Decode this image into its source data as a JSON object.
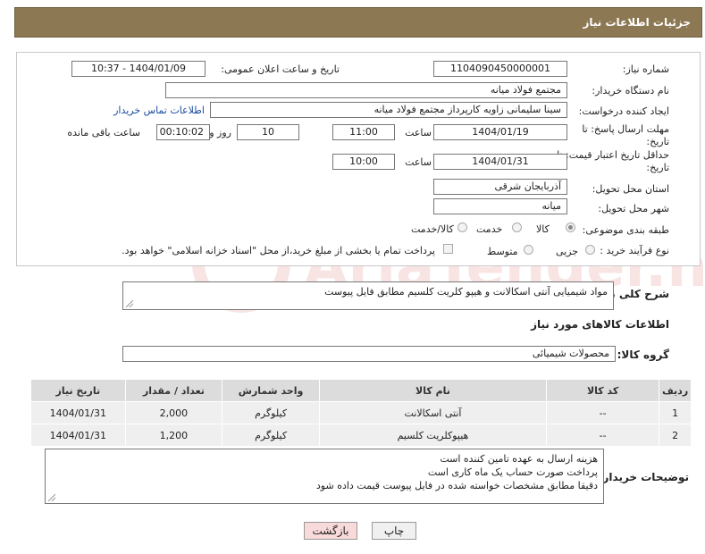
{
  "header": {
    "title": "جزئیات اطلاعات نیاز"
  },
  "fields": {
    "need_number_label": "شماره نیاز:",
    "need_number": "1104090450000001",
    "announce_label": "تاریخ و ساعت اعلان عمومی:",
    "announce_value": "1404/01/09 - 10:37",
    "buyer_org_label": "نام دستگاه خریدار:",
    "buyer_org": "مجتمع فولاد میانه",
    "requester_label": "ایجاد کننده درخواست:",
    "requester": "سینا سلیمانی زاویه کارپرداز مجتمع فولاد میانه",
    "contact_link": "اطلاعات تماس خریدار",
    "reply_deadline_label": "مهلت ارسال پاسخ: تا تاریخ:",
    "reply_date": "1404/01/19",
    "time_label": "ساعت",
    "reply_time": "11:00",
    "days_value": "10",
    "days_label": "روز و",
    "remaining_value": "00:10:02",
    "remaining_label": "ساعت باقی مانده",
    "price_validity_label": "حداقل تاریخ اعتبار قیمت: تا تاریخ:",
    "price_date": "1404/01/31",
    "price_time": "10:00",
    "province_label": "استان محل تحویل:",
    "province": "آذربایجان شرقی",
    "city_label": "شهر محل تحویل:",
    "city": "میانه",
    "category_label": "طبقه بندی موضوعی:",
    "category_options": [
      "کالا",
      "خدمت",
      "کالا/خدمت"
    ],
    "process_label": "نوع فرآیند خرید :",
    "process_options": [
      "جزیی",
      "متوسط"
    ],
    "payment_note": "پرداخت تمام یا بخشی از مبلغ خرید،از محل \"اسناد خزانه اسلامی\" خواهد بود."
  },
  "description": {
    "label": "شرح کلی نیاز:",
    "text": "مواد شیمیایی آنتی اسکالانت و هیپو کلریت کلسیم مطابق فایل پیوست"
  },
  "goods": {
    "section_title": "اطلاعات کالاهای مورد نیاز",
    "group_label": "گروه کالا:",
    "group_value": "محصولات شیمیائی",
    "columns": [
      "ردیف",
      "کد کالا",
      "نام کالا",
      "واحد شمارش",
      "تعداد / مقدار",
      "تاریخ نیاز"
    ],
    "rows": [
      [
        "1",
        "--",
        "آنتی اسکالانت",
        "کیلوگرم",
        "2,000",
        "1404/01/31"
      ],
      [
        "2",
        "--",
        "هیپوکلریت کلسیم",
        "کیلوگرم",
        "1,200",
        "1404/01/31"
      ]
    ]
  },
  "buyer_notes": {
    "label": "توضیحات خریدار:",
    "lines": [
      "هزینه ارسال به عهده تامین کننده است",
      "پرداخت صورت حساب یک ماه کاری است",
      "دقیقا مطابق مشخصات خواسته شده در فایل پیوست قیمت داده شود"
    ]
  },
  "buttons": {
    "print": "چاپ",
    "back": "بازگشت"
  },
  "watermark": "AriaTender.net",
  "colors": {
    "header": "#8c7853",
    "link": "#1a4ba0",
    "back_button": "#f9dada"
  }
}
